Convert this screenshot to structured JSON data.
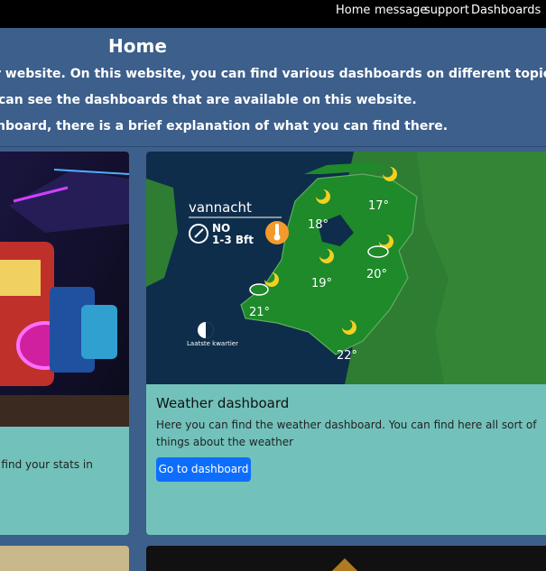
{
  "navbar": {
    "links": [
      "Home",
      "message",
      "support"
    ],
    "dropdown_label": "Dashboards"
  },
  "hero": {
    "title": "Home",
    "line1": "r website. On this website, you can find various dashboards on different topics.",
    "line2": "can see the dashboards that are available on this website.",
    "line3": "hboard, there is a brief explanation of what you can find there."
  },
  "cards": {
    "left": {
      "text": "n find your stats in"
    },
    "weather": {
      "title": "Weather dashboard",
      "text": "Here you can find the weather dashboard. You can find here all sort of things about the weather",
      "button": "Go to dashboard",
      "image": {
        "label_vannacht": "vannacht",
        "wind_dir": "NO",
        "wind_force": "1-3 Bft",
        "moon_phase": "Laatste kwartier",
        "temps": [
          "17°",
          "18°",
          "20°",
          "19°",
          "21°",
          "22°"
        ]
      }
    }
  },
  "colors": {
    "navbar": "#000000",
    "hero_bg": "#3d5f8c",
    "card_bg": "#72c2bb",
    "button": "#0d6efd"
  }
}
